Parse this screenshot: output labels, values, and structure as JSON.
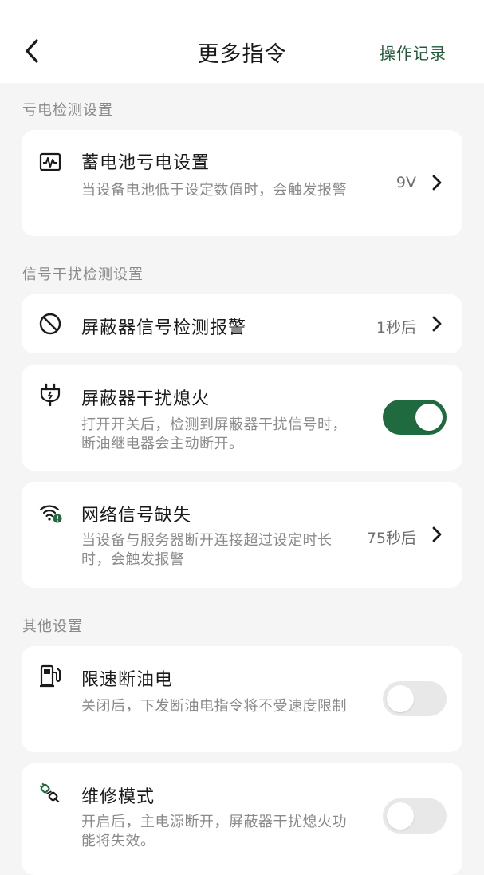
{
  "header": {
    "title": "更多指令",
    "action_label": "操作记录"
  },
  "sections": [
    {
      "title": "亏电检测设置",
      "items": [
        {
          "title": "蓄电池亏电设置",
          "desc": "当设备电池低于设定数值时，会触发报警",
          "value": "9V",
          "icon": "battery-pulse-icon"
        }
      ]
    },
    {
      "title": "信号干扰检测设置",
      "items": [
        {
          "title": "屏蔽器信号检测报警",
          "value": "1秒后",
          "icon": "prohibit-icon"
        },
        {
          "title": "屏蔽器干扰熄火",
          "desc": "打开开关后，检测到屏蔽器干扰信号时，断油继电器会主动断开。",
          "toggle": true,
          "icon": "plug-bolt-icon"
        },
        {
          "title": "网络信号缺失",
          "desc": "当设备与服务器断开连接超过设定时长时，会触发报警",
          "value": "75秒后",
          "icon": "wifi-alert-icon"
        }
      ]
    },
    {
      "title": "其他设置",
      "items": [
        {
          "title": "限速断油电",
          "desc": "关闭后，下发断油电指令将不受速度限制",
          "toggle": false,
          "icon": "fuel-pump-icon"
        },
        {
          "title": "维修模式",
          "desc": "开启后，主电源断开，屏蔽器干扰熄火功能将失效。",
          "toggle": false,
          "icon": "unplug-icon"
        }
      ]
    }
  ],
  "colors": {
    "accent": "#1f6b3f",
    "link": "#1f5a38",
    "background": "#f5f5f5"
  }
}
